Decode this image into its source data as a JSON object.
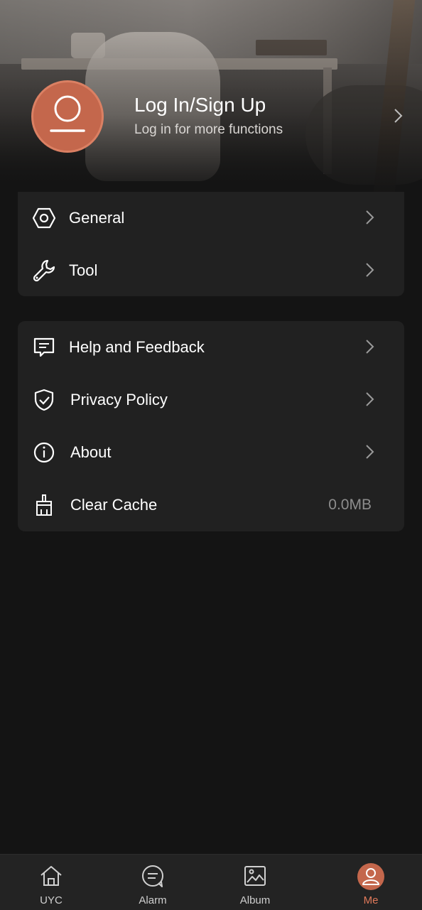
{
  "profile": {
    "title": "Log In/Sign Up",
    "subtitle": "Log in for more functions",
    "avatar_icon": "user-icon",
    "accent": "#C4674C"
  },
  "menu_group_1": [
    {
      "label": "General",
      "icon": "hexagon-settings-icon"
    },
    {
      "label": "Tool",
      "icon": "wrench-icon"
    }
  ],
  "menu_group_2": [
    {
      "label": "Help and Feedback",
      "icon": "message-icon"
    },
    {
      "label": "Privacy Policy",
      "icon": "shield-check-icon"
    },
    {
      "label": "About",
      "icon": "info-icon"
    },
    {
      "label": "Clear Cache",
      "icon": "broom-icon",
      "value": "0.0MB"
    }
  ],
  "bottom_nav": [
    {
      "label": "UYC",
      "icon": "home-icon"
    },
    {
      "label": "Alarm",
      "icon": "chat-icon"
    },
    {
      "label": "Album",
      "icon": "image-icon"
    },
    {
      "label": "Me",
      "icon": "user-icon",
      "active": true
    }
  ],
  "colors": {
    "background": "#141414",
    "card": "#212121",
    "accent": "#E0795A",
    "secondary_text": "#8D8D8D"
  }
}
